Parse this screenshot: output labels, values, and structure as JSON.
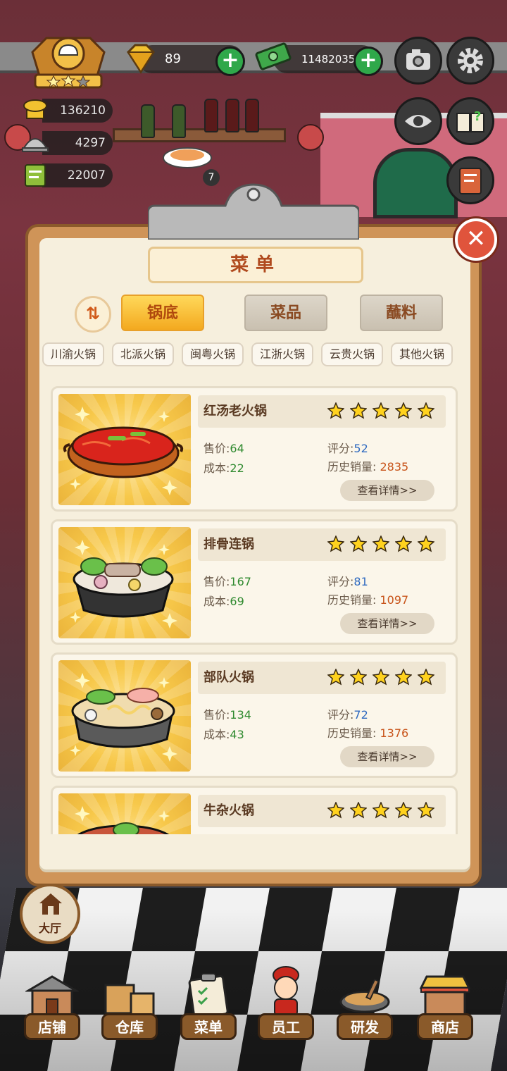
{
  "hud": {
    "gems": "89",
    "cash": "11482035",
    "stats": [
      "136210",
      "4297",
      "22007"
    ],
    "badge_count": "7"
  },
  "menu": {
    "title": "菜单",
    "tabs": [
      {
        "label": "锅底",
        "active": true
      },
      {
        "label": "菜品",
        "active": false
      },
      {
        "label": "蘸料",
        "active": false
      }
    ],
    "filters": [
      "川渝火锅",
      "北派火锅",
      "闽粤火锅",
      "江浙火锅",
      "云贵火锅",
      "其他火锅"
    ],
    "labels": {
      "price": "售价:",
      "cost": "成本:",
      "score": "评分:",
      "sales": "历史销量:",
      "detail": "查看详情>>"
    },
    "dishes": [
      {
        "name": "红汤老火锅",
        "price": "64",
        "cost": "22",
        "score": "52",
        "sales": "2835",
        "stars": 5,
        "icon": "red-soup-hotpot"
      },
      {
        "name": "排骨连锅",
        "price": "167",
        "cost": "69",
        "score": "81",
        "sales": "1097",
        "stars": 5,
        "icon": "pork-rib-hotpot"
      },
      {
        "name": "部队火锅",
        "price": "134",
        "cost": "43",
        "score": "72",
        "sales": "1376",
        "stars": 5,
        "icon": "army-stew-hotpot"
      },
      {
        "name": "牛杂火锅",
        "price": "",
        "cost": "",
        "score": "",
        "sales": "",
        "stars": 5,
        "icon": "beef-offal-hotpot"
      }
    ]
  },
  "hall": {
    "label": "大厅"
  },
  "nav": [
    {
      "label": "店铺",
      "icon": "shop-building-icon"
    },
    {
      "label": "仓库",
      "icon": "warehouse-boxes-icon"
    },
    {
      "label": "菜单",
      "icon": "menu-clipboard-icon"
    },
    {
      "label": "员工",
      "icon": "staff-chef-icon"
    },
    {
      "label": "研发",
      "icon": "research-pot-icon"
    },
    {
      "label": "商店",
      "icon": "store-stall-icon"
    }
  ],
  "colors": {
    "accent": "#f3a91f",
    "close": "#e0543c",
    "plus": "#2fa84a",
    "panel": "#cf9458"
  }
}
